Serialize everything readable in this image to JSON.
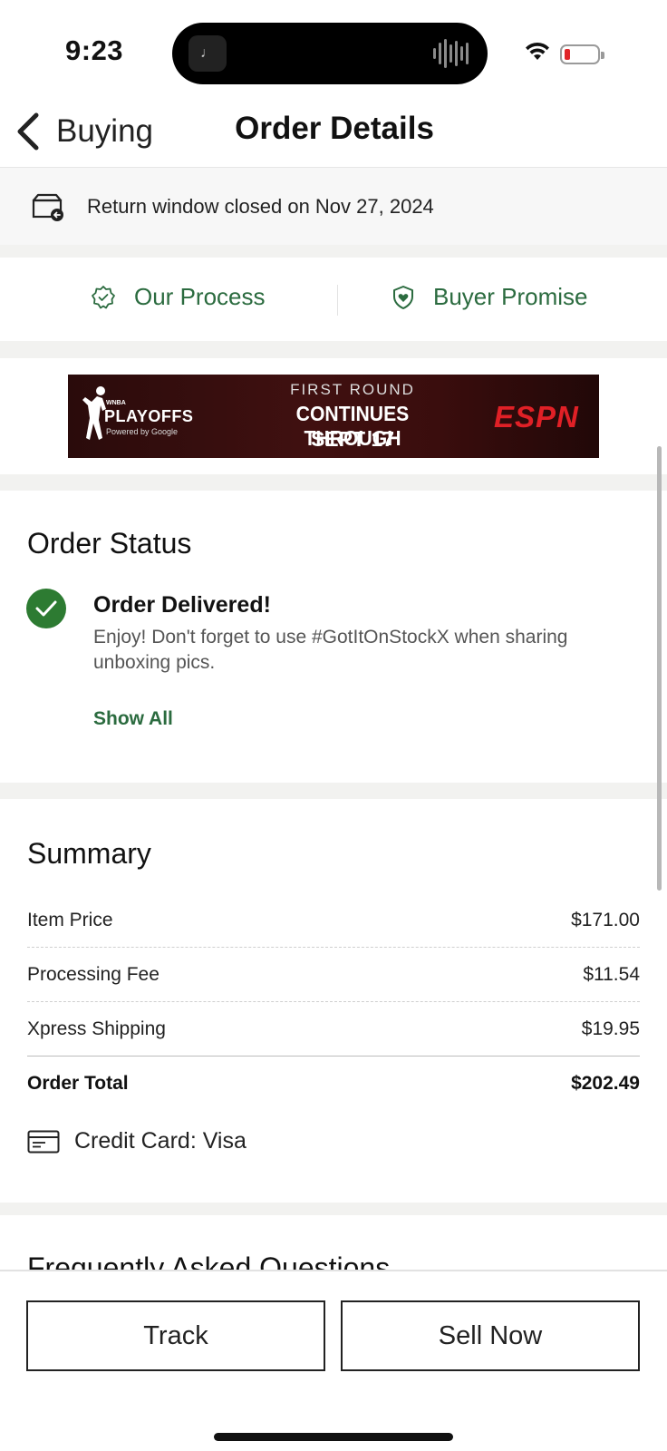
{
  "status_bar": {
    "time": "9:23",
    "battery_color": "#e0262a"
  },
  "nav": {
    "back_label": "Buying",
    "title": "Order Details"
  },
  "return_window": {
    "text": "Return window closed on Nov 27, 2024",
    "icon": "return-box-icon"
  },
  "links": {
    "process_label": "Our Process",
    "promise_label": "Buyer Promise",
    "accent": "#2b6b3f"
  },
  "banner": {
    "brand_small": "WNBA",
    "brand": "PLAYOFFS",
    "powered": "Powered by Google",
    "line1": "FIRST ROUND",
    "line2": "CONTINUES THROUGH",
    "line3": "SEPT 17",
    "network": "ESPN"
  },
  "order_status": {
    "title": "Order Status",
    "status": "Order Delivered!",
    "message": "Enjoy! Don't forget to use #GotItOnStockX when sharing unboxing pics.",
    "show_all": "Show All",
    "check_color": "#2d7b32"
  },
  "summary": {
    "title": "Summary",
    "rows": [
      {
        "label": "Item Price",
        "value": "$171.00"
      },
      {
        "label": "Processing Fee",
        "value": "$11.54"
      },
      {
        "label": "Xpress Shipping",
        "value": "$19.95"
      },
      {
        "label": "Order Total",
        "value": "$202.49"
      }
    ],
    "payment": "Credit Card: Visa"
  },
  "faq": {
    "title": "Frequently Asked Questions"
  },
  "actions": {
    "track": "Track",
    "sell": "Sell Now"
  }
}
